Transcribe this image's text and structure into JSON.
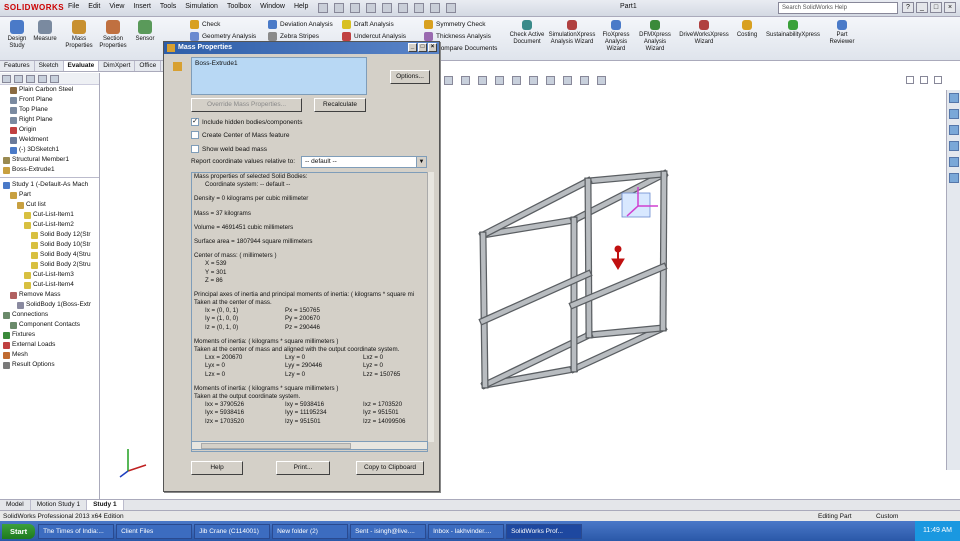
{
  "app": {
    "logo_text": "SOLIDWORKS",
    "document_title": "Part1",
    "menus": [
      "File",
      "Edit",
      "View",
      "Insert",
      "Tools",
      "Simulation",
      "Toolbox",
      "Window",
      "Help"
    ],
    "search_placeholder": "Search SolidWorks Help"
  },
  "ribbon": {
    "large_buttons": [
      {
        "label": "Design Study",
        "icon": "design-study-icon",
        "color": "#4a7ac8"
      },
      {
        "label": "Measure",
        "icon": "measure-icon",
        "color": "#7a8aa0"
      },
      {
        "label": "Mass Properties",
        "icon": "mass-properties-icon",
        "color": "#c89030"
      },
      {
        "label": "Section Properties",
        "icon": "section-properties-icon",
        "color": "#c07040"
      },
      {
        "label": "Sensor",
        "icon": "sensor-icon",
        "color": "#5a9a5a"
      }
    ],
    "small_buttons": [
      {
        "label": "Check",
        "icon": "check-icon",
        "color": "#d8a020"
      },
      {
        "label": "Geometry Analysis",
        "icon": "geometry-analysis-icon",
        "color": "#6a8ad0"
      },
      {
        "label": "Deviation Analysis",
        "icon": "deviation-analysis-icon",
        "color": "#4a7ac8"
      },
      {
        "label": "Zebra Stripes",
        "icon": "zebra-stripes-icon",
        "color": "#8a8a8a"
      },
      {
        "label": "Draft Analysis",
        "icon": "draft-analysis-icon",
        "color": "#d8c020"
      },
      {
        "label": "Undercut Analysis",
        "icon": "undercut-analysis-icon",
        "color": "#c04040"
      },
      {
        "label": "Symmetry Check",
        "icon": "symmetry-check-icon",
        "color": "#d8a020"
      },
      {
        "label": "Thickness Analysis",
        "icon": "thickness-analysis-icon",
        "color": "#9a6ab0"
      },
      {
        "label": "Compare Documents",
        "icon": "compare-documents-icon",
        "color": "#4a8ac8"
      }
    ],
    "addin_buttons": [
      {
        "label": "Check Active Document",
        "icon": "check-active-document-icon",
        "color": "#3a8a8a"
      },
      {
        "label": "SimulationXpress Analysis Wizard",
        "icon": "simulationxpress-icon",
        "color": "#b04040"
      },
      {
        "label": "FloXpress Analysis Wizard",
        "icon": "floxpress-icon",
        "color": "#4a7ac8"
      },
      {
        "label": "DFMXpress Analysis Wizard",
        "icon": "dfmxpress-icon",
        "color": "#3a8a3a"
      },
      {
        "label": "DriveWorksXpress Wizard",
        "icon": "driveworksxpress-icon",
        "color": "#b04040"
      },
      {
        "label": "Costing",
        "icon": "costing-icon",
        "color": "#d8a020"
      },
      {
        "label": "SustainabilityXpress",
        "icon": "sustainabilityxpress-icon",
        "color": "#3aa03a"
      },
      {
        "label": "Part Reviewer",
        "icon": "part-reviewer-icon",
        "color": "#4a7ac8"
      }
    ]
  },
  "command_tabs": [
    "Features",
    "Sketch",
    "Evaluate",
    "DimXpert",
    "Office"
  ],
  "command_tabs_active": "Evaluate",
  "feature_tree": [
    {
      "label": "Plain Carbon Steel",
      "icon": "material-icon",
      "color": "#8a6a40",
      "indent": 1
    },
    {
      "label": "Front Plane",
      "icon": "plane-icon",
      "color": "#7a8aa0",
      "indent": 1
    },
    {
      "label": "Top Plane",
      "icon": "plane-icon",
      "color": "#7a8aa0",
      "indent": 1
    },
    {
      "label": "Right Plane",
      "icon": "plane-icon",
      "color": "#7a8aa0",
      "indent": 1
    },
    {
      "label": "Origin",
      "icon": "origin-icon",
      "color": "#c04040",
      "indent": 1
    },
    {
      "label": "Weldment",
      "icon": "weldment-icon",
      "color": "#6a7a9a",
      "indent": 1
    },
    {
      "label": "(-) 3DSketch1",
      "icon": "sketch-icon",
      "color": "#4a7ac8",
      "indent": 1
    },
    {
      "label": "Structural Member1",
      "icon": "structural-member-icon",
      "color": "#9a8a50",
      "indent": 0
    },
    {
      "label": "Boss-Extrude1",
      "icon": "extrude-icon",
      "color": "#c8a040",
      "indent": 0
    }
  ],
  "sim_tree": [
    {
      "label": "Study 1 (-Default-As Mach",
      "icon": "study-icon",
      "color": "#4a7ac8",
      "indent": 0
    },
    {
      "label": "Part",
      "icon": "part-icon",
      "color": "#c8a040",
      "indent": 1
    },
    {
      "label": "Cut list",
      "icon": "cut-list-icon",
      "color": "#c8a040",
      "indent": 2
    },
    {
      "label": "Cut-List-Item1",
      "icon": "cut-list-item-icon",
      "color": "#d8c040",
      "indent": 3
    },
    {
      "label": "Cut-List-Item2",
      "icon": "cut-list-item-icon",
      "color": "#d8c040",
      "indent": 3
    },
    {
      "label": "Solid Body 12(Str",
      "icon": "solid-body-icon",
      "color": "#d8c040",
      "indent": 4
    },
    {
      "label": "Solid Body 10(Str",
      "icon": "solid-body-icon",
      "color": "#d8c040",
      "indent": 4
    },
    {
      "label": "Solid Body 4(Stru",
      "icon": "solid-body-icon",
      "color": "#d8c040",
      "indent": 4
    },
    {
      "label": "Solid Body 2(Stru",
      "icon": "solid-body-icon",
      "color": "#d8c040",
      "indent": 4
    },
    {
      "label": "Cut-List-Item3",
      "icon": "cut-list-item-icon",
      "color": "#d8c040",
      "indent": 3
    },
    {
      "label": "Cut-List-Item4",
      "icon": "cut-list-item-icon",
      "color": "#d8c040",
      "indent": 3
    },
    {
      "label": "Remove Mass",
      "icon": "remove-mass-icon",
      "color": "#b06060",
      "indent": 1
    },
    {
      "label": "SolidBody 1(Boss-Extr",
      "icon": "solid-body-icon",
      "color": "#8a8aa0",
      "indent": 2
    },
    {
      "label": "Connections",
      "icon": "connections-icon",
      "color": "#6a8a6a",
      "indent": 0
    },
    {
      "label": "Component Contacts",
      "icon": "component-contacts-icon",
      "color": "#6a8a6a",
      "indent": 1
    },
    {
      "label": "Fixtures",
      "icon": "fixtures-icon",
      "color": "#3a8a3a",
      "indent": 0
    },
    {
      "label": "External Loads",
      "icon": "external-loads-icon",
      "color": "#c04040",
      "indent": 0
    },
    {
      "label": "Mesh",
      "icon": "mesh-icon",
      "color": "#c06a30",
      "indent": 0
    },
    {
      "label": "Result Options",
      "icon": "result-options-icon",
      "color": "#7a7a7a",
      "indent": 0
    }
  ],
  "dialog": {
    "title": "Mass Properties",
    "selected_item": "Boss-Extrude1",
    "options_button": "Options...",
    "override_button": "Override Mass Properties...",
    "recalculate_button": "Recalculate",
    "checkboxes": [
      {
        "label": "Include hidden bodies/components",
        "checked": true
      },
      {
        "label": "Create Center of Mass feature",
        "checked": false
      },
      {
        "label": "Show weld bead mass",
        "checked": false
      }
    ],
    "coord_label": "Report coordinate values relative to:",
    "coord_value": "-- default --",
    "help_button": "Help",
    "print_button": "Print...",
    "copy_button": "Copy to Clipboard",
    "results": {
      "header": "Mass properties of selected Solid Bodies:",
      "coordinate_system": "Coordinate system: -- default --",
      "density": "Density = 0 kilograms per cubic millimeter",
      "mass": "Mass = 37 kilograms",
      "volume": "Volume = 4691451 cubic millimeters",
      "surface_area": "Surface area = 1807944 square millimeters",
      "com_header": "Center of mass: ( millimeters )",
      "com": [
        "X = 539",
        "Y = 301",
        "Z = 86"
      ],
      "principal_header": "Principal axes of inertia and principal moments of inertia: ( kilograms * square mi",
      "principal_sub": "Taken at the center of mass.",
      "principal_rows": [
        [
          "Ix = (0, 0, 1)",
          "Px = 150765"
        ],
        [
          "Iy = (1, 0, 0)",
          "Py = 200670"
        ],
        [
          "Iz = (0, 1, 0)",
          "Pz = 290446"
        ]
      ],
      "moi_header": "Moments of inertia: ( kilograms * square millimeters )",
      "moi_sub": "Taken at the center of mass and aligned with the output coordinate system.",
      "moi_rows": [
        [
          "Lxx = 200670",
          "Lxy = 0",
          "Lxz = 0"
        ],
        [
          "Lyx = 0",
          "Lyy = 290446",
          "Lyz = 0"
        ],
        [
          "Lzx = 0",
          "Lzy = 0",
          "Lzz = 150765"
        ]
      ],
      "moi2_header": "Moments of inertia: ( kilograms * square millimeters )",
      "moi2_sub": "Taken at the output coordinate system.",
      "moi2_rows": [
        [
          "Ixx = 3790526",
          "Ixy = 5938416",
          "Ixz = 1703520"
        ],
        [
          "Iyx = 5938416",
          "Iyy = 11195234",
          "Iyz = 951501"
        ],
        [
          "Izx = 1703520",
          "Izy = 951501",
          "Izz = 14099506"
        ]
      ]
    }
  },
  "bottom_tabs": [
    "Model",
    "Motion Study 1",
    "Study 1"
  ],
  "bottom_tabs_active": "Study 1",
  "status": {
    "edition": "SolidWorks Professional 2013 x64 Edition",
    "mode": "Editing Part",
    "units": "Custom"
  },
  "taskbar": {
    "start": "Start",
    "items": [
      "The Times of India:...",
      "Client Files",
      "Jib Crane (C114001)",
      "New folder (2)",
      "Sent - isingh@live....",
      "Inbox - lakhvinder....",
      "SolidWorks Prof..."
    ],
    "active_item": "SolidWorks Prof...",
    "clock": "11:49 AM"
  },
  "colors": {
    "frame_steel": "#b8bcc0",
    "frame_dark": "#5a5e62",
    "com_marker": "#c01010",
    "triad_x": "#c02020",
    "triad_y": "#20a020",
    "triad_z": "#2040c0"
  }
}
